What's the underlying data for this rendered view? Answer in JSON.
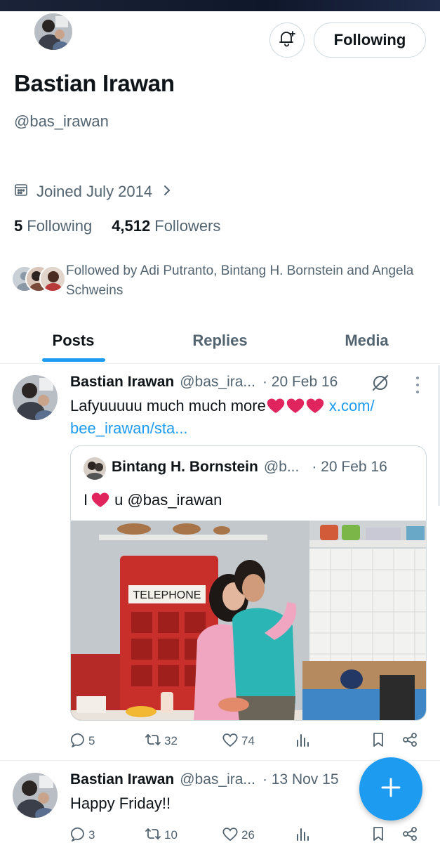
{
  "profile": {
    "display_name": "Bastian Irawan",
    "handle": "@bas_irawan",
    "joined": "Joined July 2014",
    "following_count": "5",
    "following_label": "Following",
    "followers_count": "4,512",
    "followers_label": "Followers",
    "follow_button_label": "Following",
    "followed_by_text": "Followed by Adi Putranto, Bintang H. Bornstein and Angela Schweins"
  },
  "tabs": [
    {
      "label": "Posts",
      "active": true
    },
    {
      "label": "Replies",
      "active": false
    },
    {
      "label": "Media",
      "active": false
    }
  ],
  "posts": [
    {
      "author": "Bastian Irawan",
      "handle": "@bas_ira...",
      "date": "· 20 Feb 16",
      "text_line1": "Lafyuuuuu much much more ",
      "link_tail": "x.com/",
      "text_line2": "bee_irawan/sta...",
      "quote": {
        "author": "Bintang H. Bornstein",
        "handle": "@b...",
        "date": "· 20 Feb 16",
        "text_before": "I ",
        "text_after": " u @bas_irawan",
        "image_sign": "TELEPHONE"
      },
      "replies": "5",
      "reposts": "32",
      "likes": "74"
    },
    {
      "author": "Bastian Irawan",
      "handle": "@bas_ira...",
      "date": "· 13 Nov 15",
      "text": "Happy Friday!!",
      "replies": "3",
      "reposts": "10",
      "likes": "26"
    }
  ],
  "icons": {
    "notify": "bell-plus-icon",
    "calendar": "calendar-icon",
    "chevron": "chevron-right-icon",
    "grok": "grok-icon",
    "reply": "reply-icon",
    "repost": "repost-icon",
    "like": "heart-icon",
    "views": "views-icon",
    "bookmark": "bookmark-icon",
    "share": "share-icon",
    "compose": "plus-icon"
  },
  "colors": {
    "accent": "#1d9bf0",
    "text_primary": "#0f1419",
    "text_secondary": "#536471",
    "heart": "#e0245e"
  }
}
